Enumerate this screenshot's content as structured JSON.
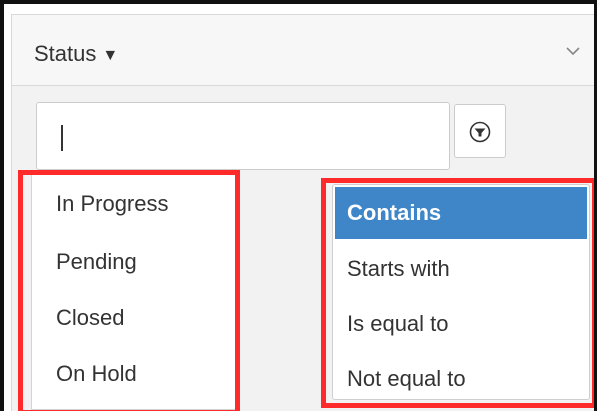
{
  "header": {
    "label": "Status",
    "caret": "▼",
    "chevron_icon": "chevron-down-icon"
  },
  "filter": {
    "input_value": "",
    "button_icon": "filter-circle-icon"
  },
  "suggestions": {
    "items": [
      {
        "label": "In Progress"
      },
      {
        "label": "Pending"
      },
      {
        "label": "Closed"
      },
      {
        "label": "On Hold"
      }
    ]
  },
  "operators": {
    "items": [
      {
        "label": "Contains",
        "selected": true
      },
      {
        "label": "Starts with",
        "selected": false
      },
      {
        "label": "Is equal to",
        "selected": false
      },
      {
        "label": "Not equal to",
        "selected": false
      }
    ]
  },
  "colors": {
    "highlight": "#ff2b2b",
    "selected_background": "#3f86c9",
    "header_background": "#f7f7f7",
    "panel_background": "#f2f2f2"
  }
}
